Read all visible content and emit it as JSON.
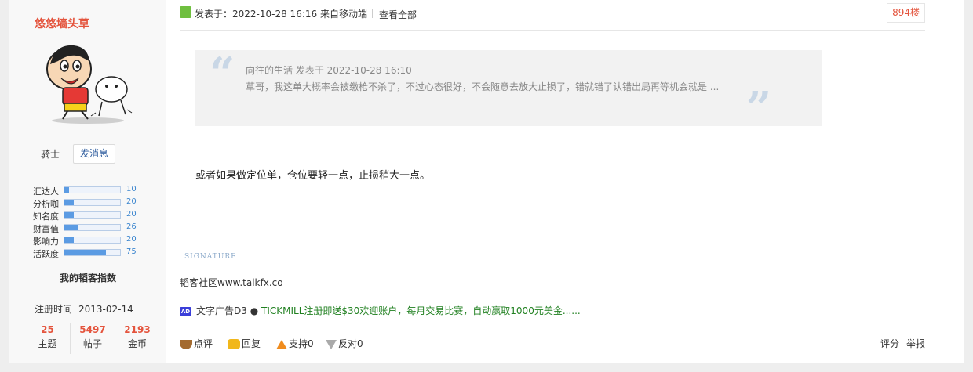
{
  "user": {
    "name": "悠悠墙头草",
    "rank": "骑士",
    "message_button": "发消息",
    "stats": [
      {
        "label": "汇达人",
        "value": "10",
        "fill": 0.08
      },
      {
        "label": "分析咖",
        "value": "20",
        "fill": 0.17
      },
      {
        "label": "知名度",
        "value": "20",
        "fill": 0.17
      },
      {
        "label": "财富值",
        "value": "26",
        "fill": 0.24
      },
      {
        "label": "影响力",
        "value": "20",
        "fill": 0.17
      },
      {
        "label": "活跃度",
        "value": "75",
        "fill": 0.75
      }
    ],
    "index_title": "我的韬客指数",
    "registered_label": "注册时间",
    "registered_date": "2013-02-14",
    "counts": [
      {
        "value": "25",
        "label": "主题"
      },
      {
        "value": "5497",
        "label": "帖子"
      },
      {
        "value": "2193",
        "label": "金币"
      }
    ]
  },
  "post": {
    "posted_at": "发表于：2022-10-28 16:16  来自移动端",
    "view_all": "查看全部",
    "floor": "894楼",
    "quote": {
      "header": "向往的生活 发表于 2022-10-28 16:10",
      "body": "草哥，我这单大概率会被缴枪不杀了，不过心态很好，不会随意去放大止损了，错就错了认错出局再等机会就是 ..."
    },
    "content": "或者如果做定位单，仓位要轻一点，止损稍大一点。",
    "signature_label": "SIGNATURE",
    "signature": "韬客社区www.talkfx.co",
    "ad": {
      "icon_text": "AD",
      "label": "文字广告D3 ●",
      "link": "TICKMILL注册即送$30欢迎账户，每月交易比赛，自动赢取1000元美金......"
    },
    "actions": {
      "comment": "点评",
      "reply": "回复",
      "support": "支持0",
      "oppose": "反对0",
      "rate": "评分",
      "report": "举报"
    }
  }
}
